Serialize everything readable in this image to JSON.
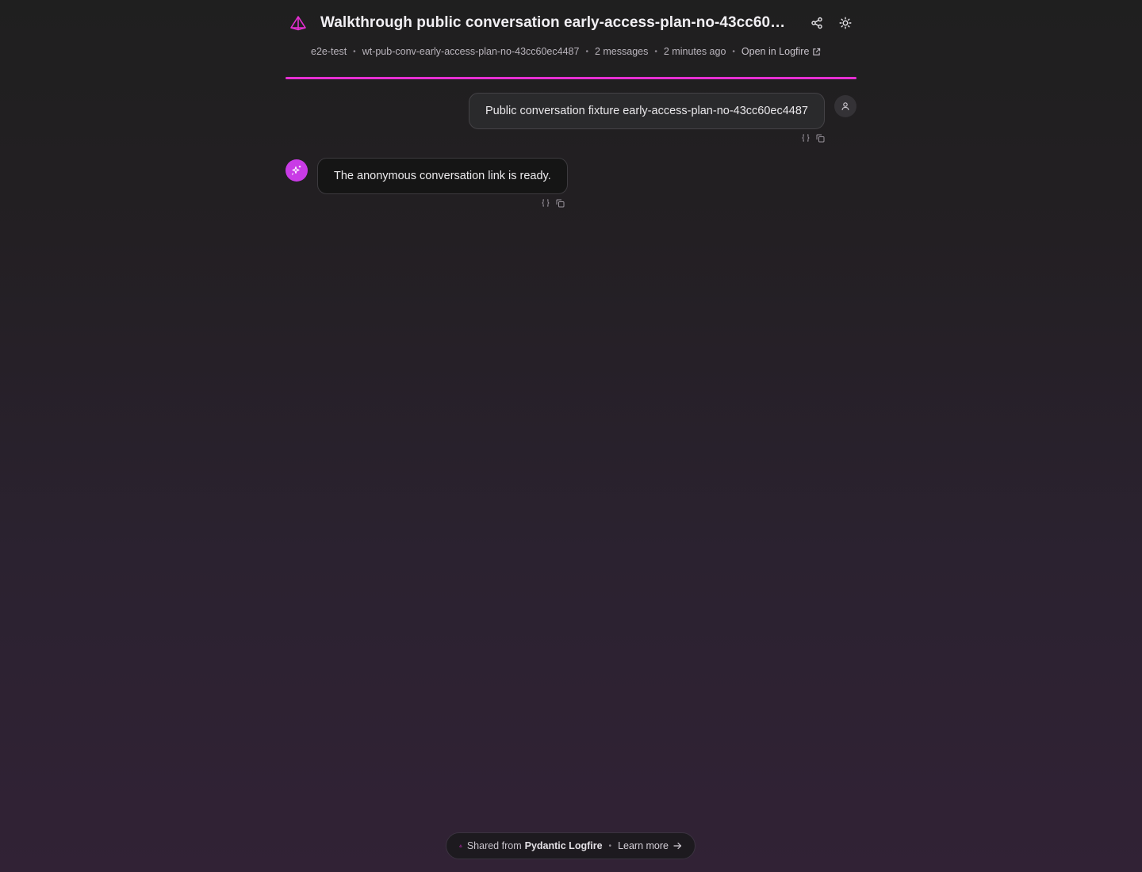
{
  "header": {
    "title": "Walkthrough public conversation early-access-plan-no-43cc60ec44...",
    "share_icon": "share-icon",
    "theme_icon": "sun-icon"
  },
  "meta": {
    "project": "e2e-test",
    "conversation_id": "wt-pub-conv-early-access-plan-no-43cc60ec4487",
    "message_count": "2 messages",
    "time": "2 minutes ago",
    "open_link": "Open in Logfire",
    "separator": "•"
  },
  "progress": {
    "percent": 100,
    "color": "#e52fd2"
  },
  "messages": [
    {
      "role": "user",
      "text": "Public conversation fixture early-access-plan-no-43cc60ec4487"
    },
    {
      "role": "assistant",
      "text": "The anonymous conversation link is ready."
    }
  ],
  "footer": {
    "prefix": "Shared from",
    "brand": "Pydantic Logfire",
    "separator": "•",
    "learn_more": "Learn more"
  },
  "colors": {
    "accent": "#e52fd2",
    "assistant_avatar": "#c93be6"
  }
}
